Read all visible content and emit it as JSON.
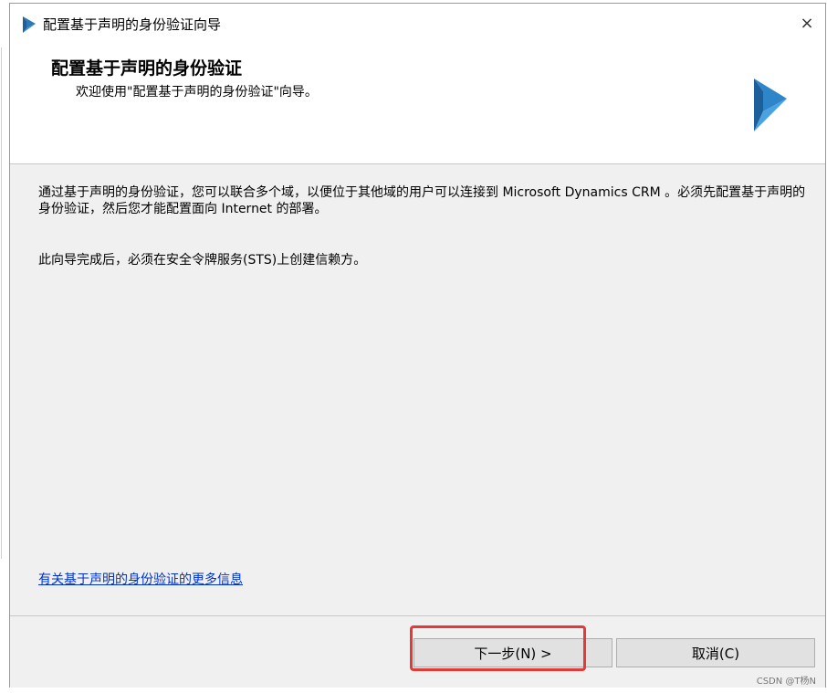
{
  "window": {
    "title": "配置基于声明的身份验证向导",
    "close_glyph": "×"
  },
  "header": {
    "title": "配置基于声明的身份验证",
    "subtitle": "欢迎使用\"配置基于声明的身份验证\"向导。"
  },
  "content": {
    "paragraph1": "通过基于声明的身份验证，您可以联合多个域，以便位于其他域的用户可以连接到 Microsoft Dynamics CRM 。必须先配置基于声明的身份验证，然后您才能配置面向 Internet 的部署。",
    "paragraph2": "此向导完成后，必须在安全令牌服务(STS)上创建信赖方。",
    "more_info_link": "有关基于声明的身份验证的更多信息"
  },
  "footer": {
    "next_label": "下一步(N) >",
    "cancel_label": "取消(C)"
  },
  "watermark": "CSDN @T杨N",
  "colors": {
    "brand": "#0078d4",
    "link": "#0033cc",
    "highlight": "#e53935"
  },
  "icons": {
    "title_logo": "dynamics-logo-icon",
    "header_logo": "dynamics-logo-icon"
  }
}
